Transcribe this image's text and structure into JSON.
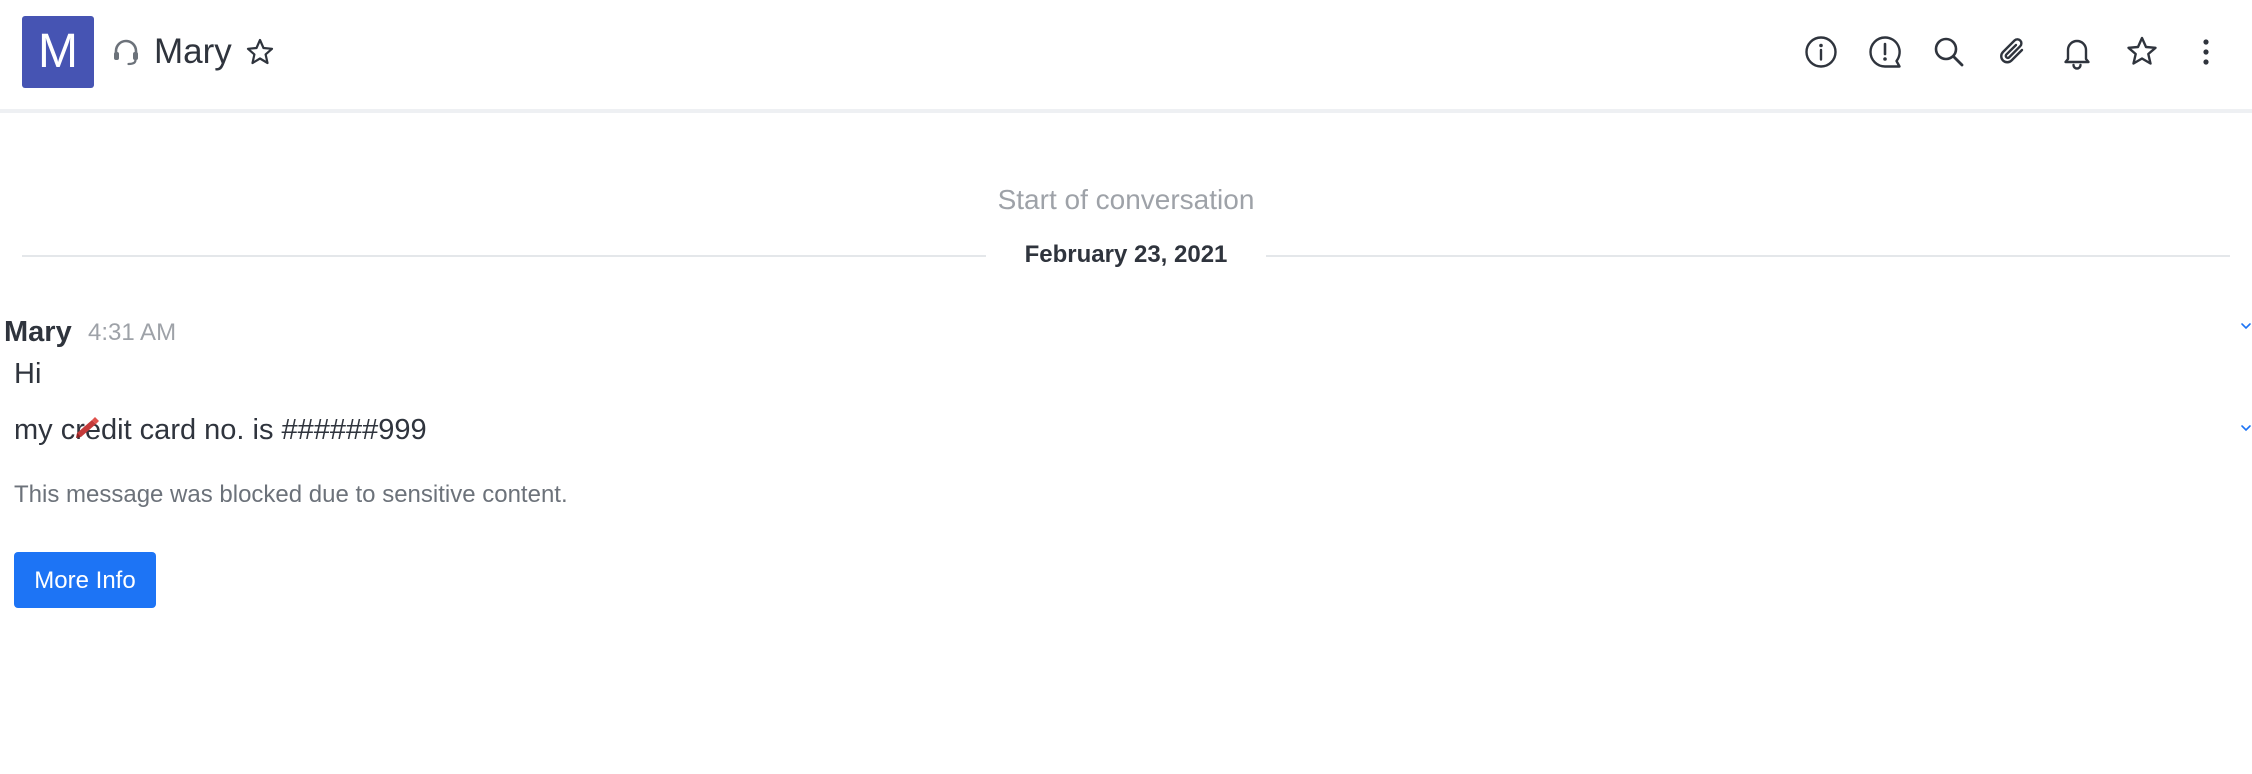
{
  "header": {
    "avatar_letter": "M",
    "title": "Mary",
    "avatar_color": "#4654b3",
    "icons": {
      "omnichannel": "headset-icon",
      "favorite": "star-outline-icon",
      "room_info": "info-circle-icon",
      "discussion": "alert-bubble-icon",
      "search": "search-icon",
      "files": "paperclip-icon",
      "notifications": "bell-icon",
      "starred": "star-icon",
      "kebab": "kebab-menu-icon"
    }
  },
  "conversation": {
    "start_text": "Start of conversation",
    "date_divider": "February 23, 2021",
    "messages": [
      {
        "author": "Mary",
        "time": "4:31 AM",
        "text": "Hi"
      },
      {
        "text": "my credit card no. is ######999"
      }
    ],
    "blocked_note": "This message was blocked due to sensitive content.",
    "more_info_label": "More Info",
    "accent_color": "#1d74f5"
  }
}
